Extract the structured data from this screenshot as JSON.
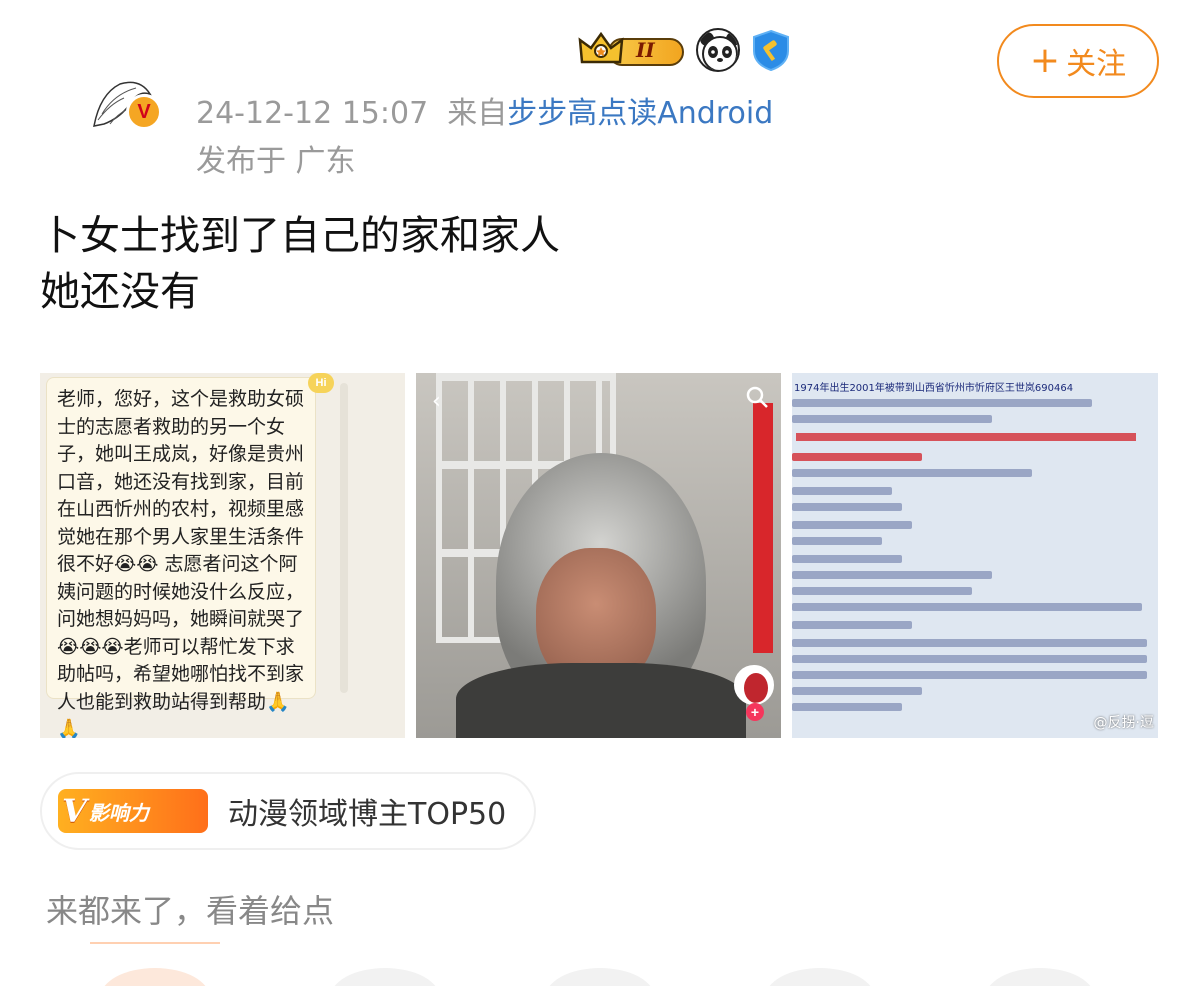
{
  "header": {
    "badge_level": "II",
    "follow_label": "关注",
    "follow_plus": "+",
    "timestamp": "24-12-12 15:07",
    "from_prefix": "来自",
    "source": "步步高点读Android",
    "location": "发布于 广东",
    "verified_mark": "V"
  },
  "post": {
    "lines": [
      "卜女士找到了自己的家和家人",
      "她还没有"
    ]
  },
  "images": {
    "image1_hi": "Hi",
    "image1_text": "老师，您好，这个是救助女硕士的志愿者救助的另一个女子，她叫王成岚，好像是贵州口音，她还没有找到家，目前在山西忻州的农村，视频里感觉她在那个男人家里生活条件很不好😭😭 志愿者问这个阿姨问题的时候她没什么反应，问她想妈妈吗，她瞬间就哭了😭😭😭老师可以帮忙发下求助帖吗，希望她哪怕找不到家人也能到救助站得到帮助🙏🙏",
    "image3_header": "1974年出生2001年被带到山西省忻州市忻府区王世岚690464",
    "image3_watermark": "@反拐·逗"
  },
  "influence": {
    "badge_letter": "V",
    "badge_label": "影响力",
    "text": "动漫领域博主TOP50"
  },
  "comment": {
    "text": "来都来了，看着给点"
  },
  "colors": {
    "accent": "#f28a1e",
    "link": "#3b78c2",
    "meta": "#9a9a9a"
  }
}
